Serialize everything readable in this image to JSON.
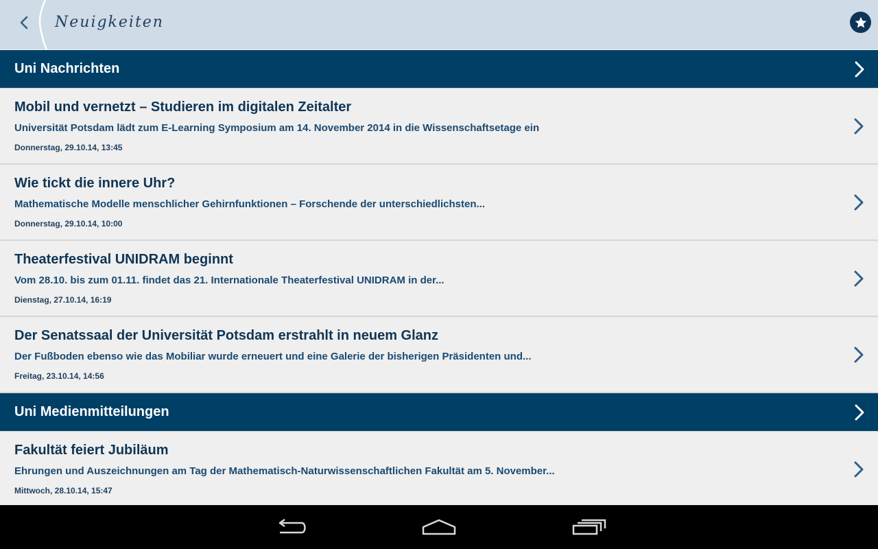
{
  "appbar": {
    "title": "Neuigkeiten",
    "back_icon": "chevron-left-icon",
    "favorite_icon": "star-icon",
    "accent": "#003f66"
  },
  "sections": [
    {
      "label": "Uni Nachrichten",
      "items": [
        {
          "title": "Mobil und vernetzt – Studieren im digitalen Zeitalter",
          "summary": "Universität Potsdam lädt zum E-Learning Symposium am 14. November 2014 in die Wissenschaftsetage ein",
          "date": "Donnerstag, 29.10.14, 13:45"
        },
        {
          "title": "Wie tickt die innere Uhr?",
          "summary": "Mathematische Modelle menschlicher Gehirnfunktionen – Forschende der unterschiedlichsten...",
          "date": "Donnerstag, 29.10.14, 10:00"
        },
        {
          "title": "Theaterfestival UNIDRAM beginnt",
          "summary": "Vom 28.10. bis zum 01.11. findet das 21. Internationale Theaterfestival UNIDRAM in der...",
          "date": "Dienstag, 27.10.14, 16:19"
        },
        {
          "title": "Der Senatssaal der Universität Potsdam erstrahlt in neuem Glanz",
          "summary": "Der Fußboden ebenso wie das Mobiliar wurde erneuert und eine Galerie der bisherigen Präsidenten und...",
          "date": "Freitag, 23.10.14, 14:56"
        }
      ]
    },
    {
      "label": "Uni Medienmitteilungen",
      "items": [
        {
          "title": "Fakultät feiert Jubiläum",
          "summary": "Ehrungen und Auszeichnungen am Tag der Mathematisch-Naturwissenschaftlichen Fakultät am 5. November...",
          "date": "Mittwoch, 28.10.14, 15:47"
        }
      ]
    }
  ],
  "navbar": {
    "icons": [
      "back-icon",
      "home-icon",
      "recent-apps-icon"
    ]
  }
}
